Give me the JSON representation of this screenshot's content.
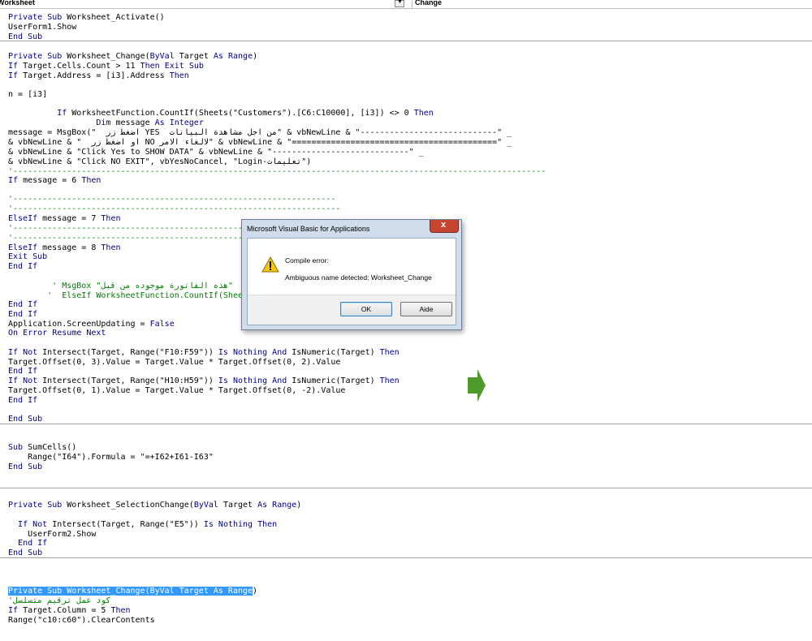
{
  "object_combo": "Worksheet",
  "procedure_combo": "Change",
  "colors": {
    "keyword": "#00008b",
    "comment": "#008000",
    "selection": "#3399ff",
    "arrow": "#4e9a2a"
  },
  "code_lines": [
    {
      "t": "Private Sub Worksheet_Activate()"
    },
    {
      "t": "UserForm1.Show"
    },
    {
      "t": "End Sub"
    },
    {
      "t": "Private Sub Worksheet_Change(ByVal Target As Range)"
    },
    {
      "t": "If Target.Cells.Count > 11 Then Exit Sub"
    },
    {
      "t": "If Target.Address = [i3].Address Then"
    },
    {
      "t": "n = [i3]"
    },
    {
      "t": "          If WorksheetFunction.CountIf(Sheets(\"Customers\").[C6:C10000], [i3]) <> 0 Then"
    },
    {
      "t": "                  Dim message As Integer"
    },
    {
      "t": "message = MsgBox(\"  اضغط زر YES  من اجل مشاهدة البيانات\" & vbNewLine & \"----------------------------\" _"
    },
    {
      "t": "& vbNewLine & \"  او اضغط زر NO لالغاء الامر\" & vbNewLine & \"==========================================\" _"
    },
    {
      "t": "& vbNewLine & \"Click Yes to SHOW DATA\" & vbNewLine & \"----------------------------\" _"
    },
    {
      "t": "& vbNewLine & \"Click NO EXIT\", vbYesNoCancel, \"Login-تعليمات\")"
    },
    {
      "t": "'-------------------------------------------------------------------------------------------------------------"
    },
    {
      "t": "If message = 6 Then"
    },
    {
      "t": "'------------------------------------------------------------------"
    },
    {
      "t": "'-------------------------------------------------------------------"
    },
    {
      "t": "ElseIf message = 7 Then"
    },
    {
      "t": "'-------------------------------------------------"
    },
    {
      "t": "'-------------------------------------------------"
    },
    {
      "t": "ElseIf message = 8 Then"
    },
    {
      "t": "Exit Sub"
    },
    {
      "t": "End If"
    },
    {
      "t": "         ' MsgBox \"هذه الفاتورة موجوده من قبل\""
    },
    {
      "t": "        '  ElseIf WorksheetFunction.CountIf(Sheets"
    },
    {
      "t": "End If"
    },
    {
      "t": "End If"
    },
    {
      "t": "Application.ScreenUpdating = False"
    },
    {
      "t": "On Error Resume Next"
    },
    {
      "t": "If Not Intersect(Target, Range(\"F10:F59\")) Is Nothing And IsNumeric(Target) Then"
    },
    {
      "t": "Target.Offset(0, 3).Value = Target.Value * Target.Offset(0, 2).Value"
    },
    {
      "t": "End If"
    },
    {
      "t": "If Not Intersect(Target, Range(\"H10:H59\")) Is Nothing And IsNumeric(Target) Then"
    },
    {
      "t": "Target.Offset(0, 1).Value = Target.Value * Target.Offset(0, -2).Value"
    },
    {
      "t": "End If"
    },
    {
      "t": "End Sub"
    },
    {
      "t": "Sub SumCells()"
    },
    {
      "t": "    Range(\"I64\").Formula = \"=+I62+I61-I63\""
    },
    {
      "t": "End Sub"
    },
    {
      "t": "Private Sub Worksheet_SelectionChange(ByVal Target As Range)"
    },
    {
      "t": "  If Not Intersect(Target, Range(\"E5\")) Is Nothing Then"
    },
    {
      "t": "    UserForm2.Show"
    },
    {
      "t": "  End If"
    },
    {
      "t": "End Sub"
    },
    {
      "t": "Private Sub Worksheet_Change(ByVal Target As Range)"
    },
    {
      "t": "'كود عمل ترقيم متسلسل"
    },
    {
      "t": "If Target.Column = 5 Then"
    },
    {
      "t": "Range(\"c10:c60\").ClearContents"
    }
  ],
  "dialog": {
    "title": "Microsoft Visual Basic for Applications",
    "close": "x",
    "icon": "warning-icon",
    "line1": "Compile error:",
    "line2": "Ambiguous name detected: Worksheet_Change",
    "ok_label": "OK",
    "aide_label": "Aide"
  }
}
